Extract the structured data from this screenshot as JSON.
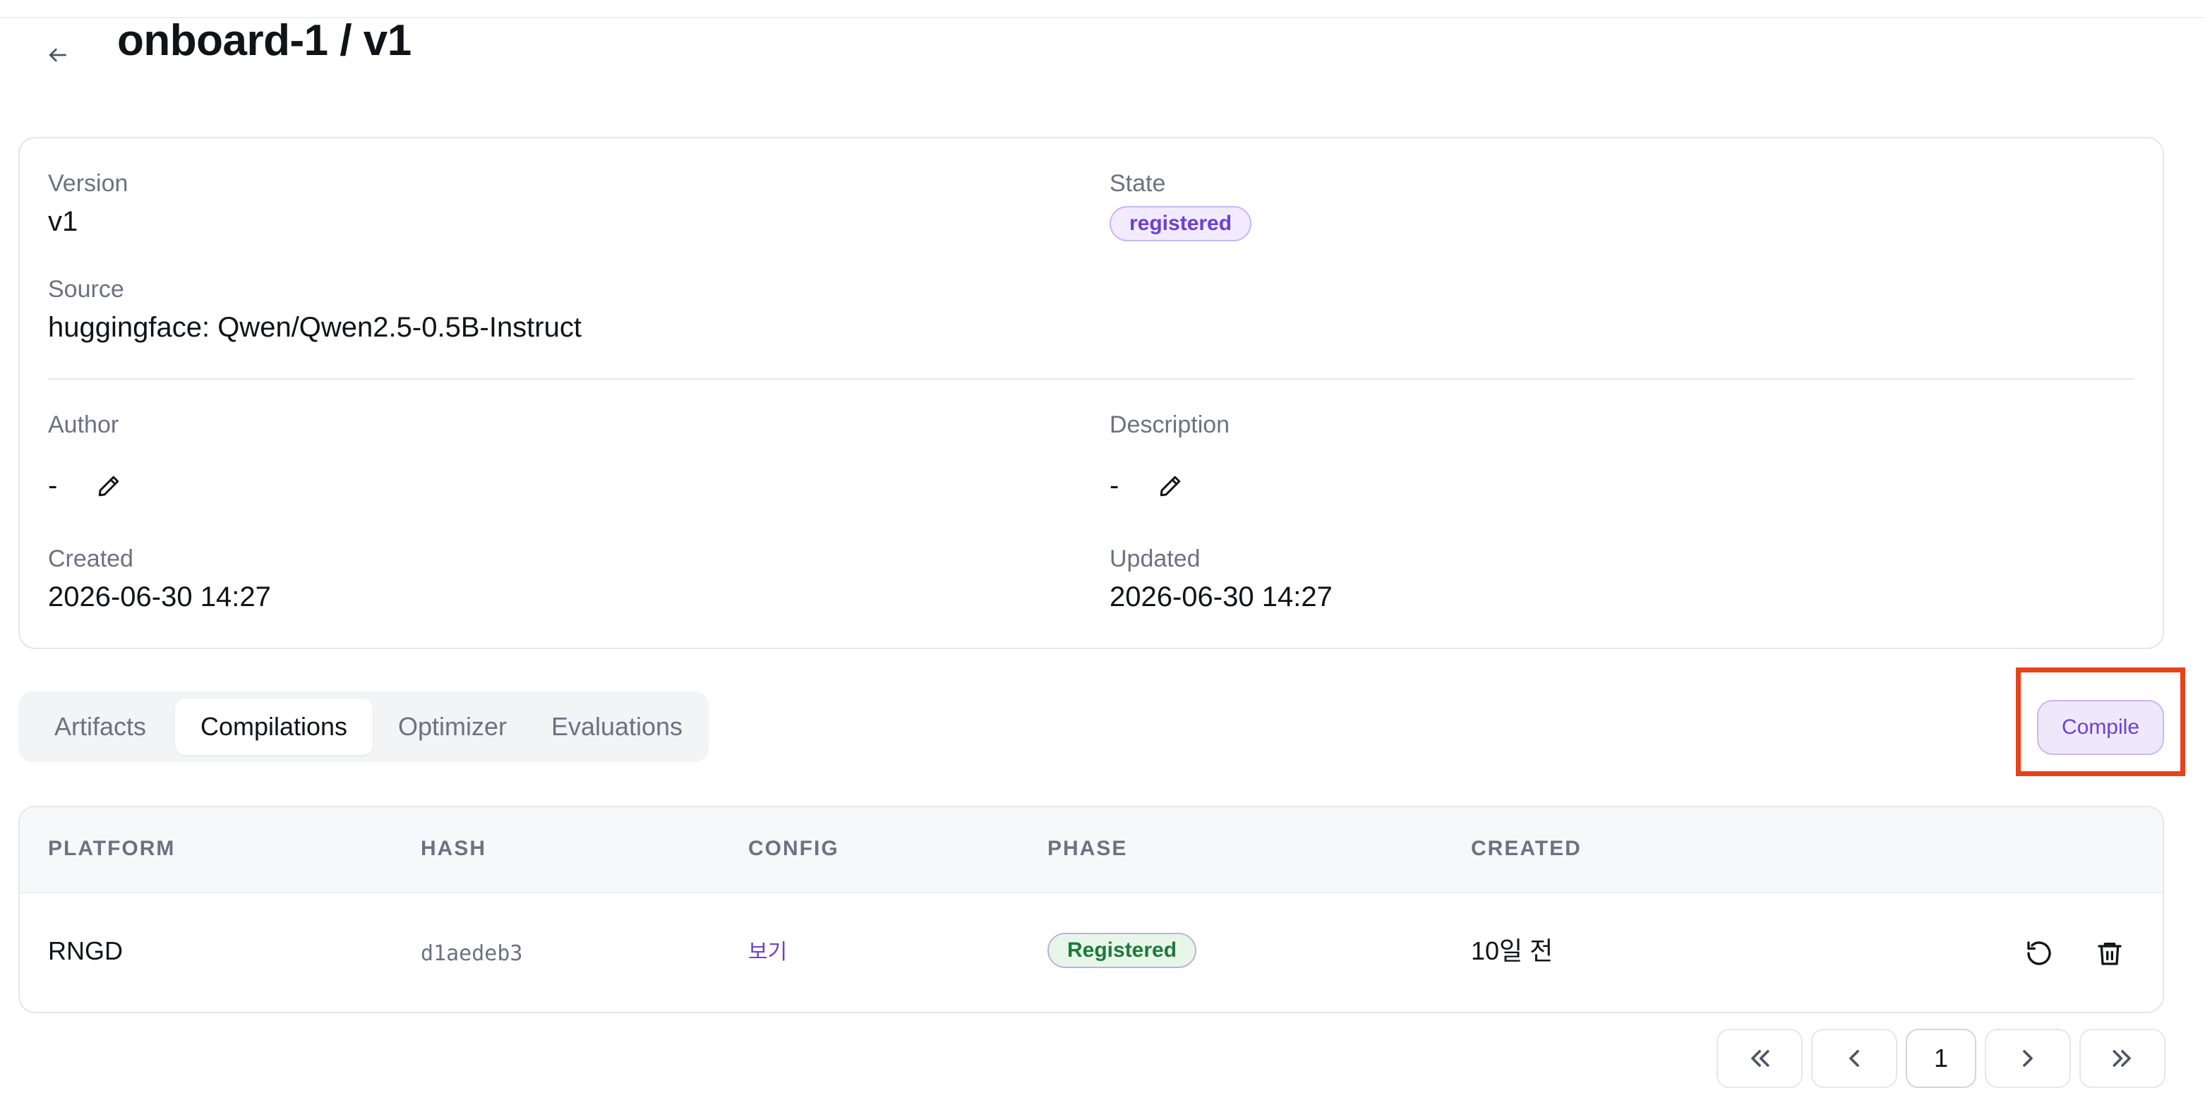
{
  "header": {
    "back_icon": "arrow-left-icon",
    "title": "onboard-1 / v1"
  },
  "details": {
    "version_label": "Version",
    "version_value": "v1",
    "state_label": "State",
    "state_value": "registered",
    "source_label": "Source",
    "source_value": "huggingface: Qwen/Qwen2.5-0.5B-Instruct",
    "author_label": "Author",
    "author_value": "-",
    "description_label": "Description",
    "description_value": "-",
    "created_label": "Created",
    "created_value": "2026-06-30 14:27",
    "updated_label": "Updated",
    "updated_value": "2026-06-30 14:27",
    "edit_icon": "pencil-icon"
  },
  "tabs": [
    {
      "label": "Artifacts",
      "active": false
    },
    {
      "label": "Compilations",
      "active": true
    },
    {
      "label": "Optimizer",
      "active": false
    },
    {
      "label": "Evaluations",
      "active": false
    }
  ],
  "actions": {
    "compile_label": "Compile"
  },
  "table": {
    "columns": [
      "PLATFORM",
      "HASH",
      "CONFIG",
      "PHASE",
      "CREATED"
    ],
    "rows": [
      {
        "platform": "RNGD",
        "hash": "d1aedeb3",
        "config": "보기",
        "phase": "Registered",
        "created": "10일 전",
        "actions": [
          "retry-icon",
          "trash-icon"
        ]
      }
    ]
  },
  "pagination": {
    "first_icon": "chevrons-left-icon",
    "prev_icon": "chevron-left-icon",
    "current_page": "1",
    "next_icon": "chevron-right-icon",
    "last_icon": "chevrons-right-icon"
  },
  "colors": {
    "accent": "#6d3fd4",
    "accent_bg": "#f1ebfd",
    "success": "#1f7a3a",
    "highlight": "#e8421a"
  }
}
